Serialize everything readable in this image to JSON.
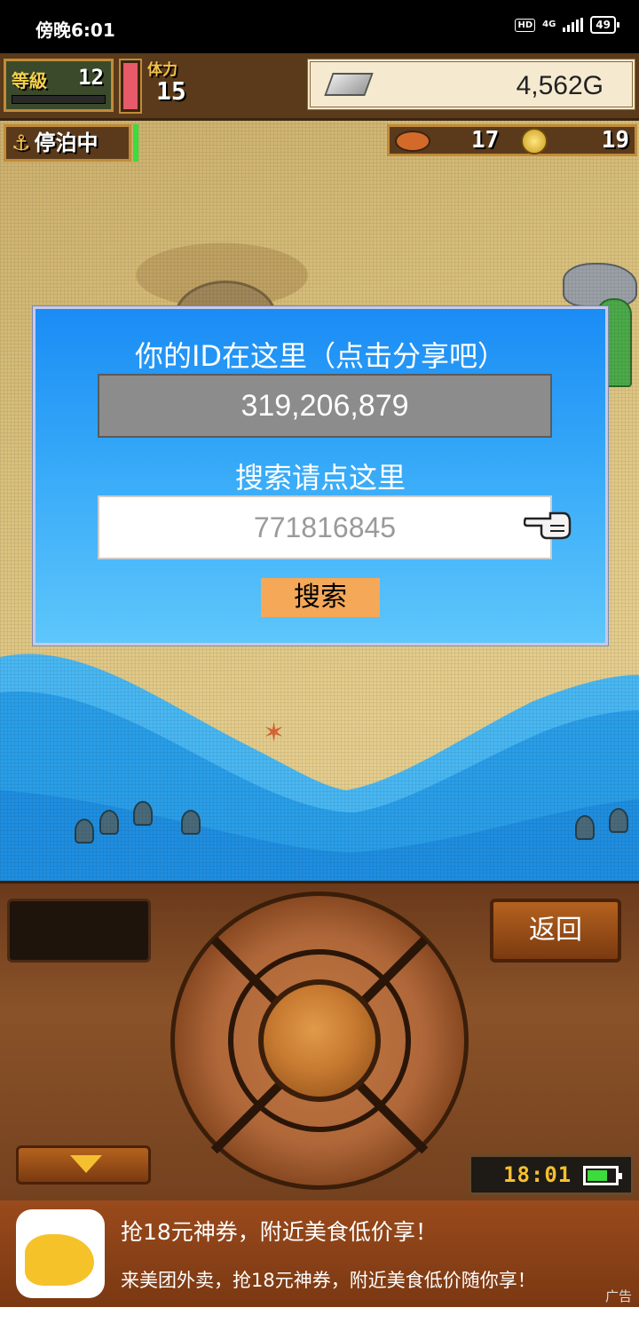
{
  "status_bar": {
    "time": "傍晚6:01",
    "hd": "HD",
    "network": "4G",
    "battery": "49"
  },
  "hud": {
    "level_label": "等級",
    "level_value": "12",
    "stamina_label": "体力",
    "stamina_value": "15",
    "gold": "4,562G",
    "status_label": "停泊中",
    "fish_count": "17",
    "coin_count": "19"
  },
  "dialog": {
    "title": "你的ID在这里（点击分享吧）",
    "id_value": "319,206,879",
    "search_label": "搜索请点这里",
    "search_placeholder": "771816845",
    "search_button": "搜索"
  },
  "controls": {
    "back_button": "返回",
    "clock": "18:01"
  },
  "ad": {
    "title": "抢18元神券，附近美食低价享！",
    "subtitle": "来美团外卖，抢18元神券，附近美食低价随你享！",
    "tag": "广告"
  },
  "colors": {
    "dialog_top": "#1a8cf5",
    "dialog_bottom": "#5ec6fb",
    "search_button": "#f5a858",
    "panel_wood": "#8a5228",
    "sea": "#3cb0f0"
  }
}
